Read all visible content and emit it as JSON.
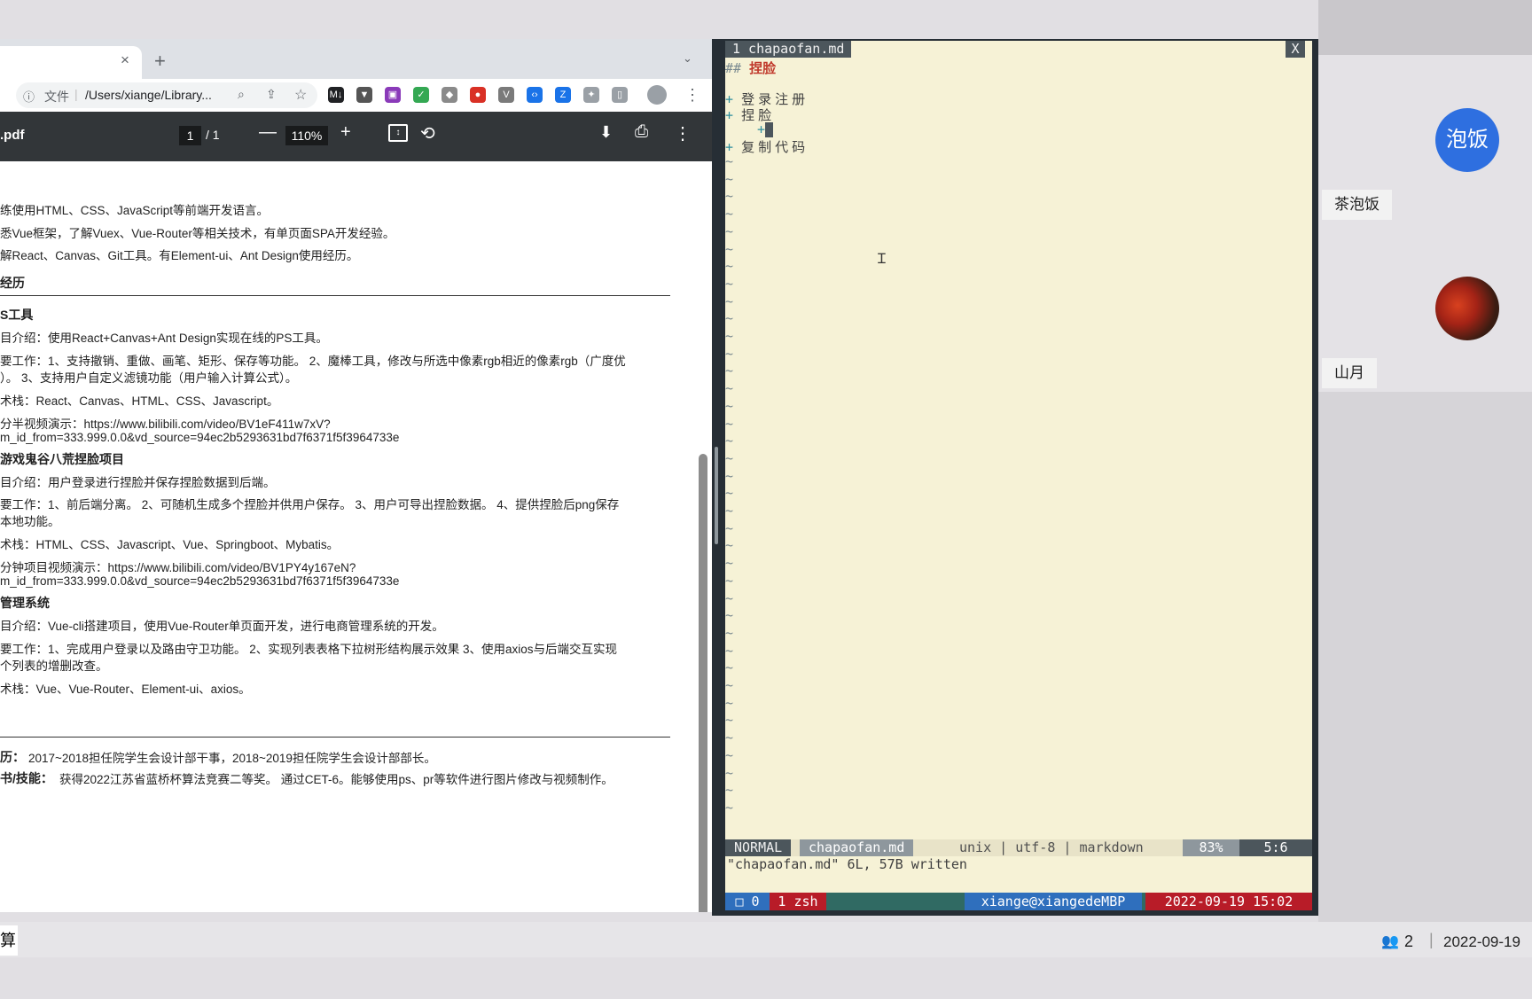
{
  "browser": {
    "tab_close": "×",
    "new_tab": "+",
    "tab_dropdown": "⌄",
    "omnibox": {
      "info_icon": "ⓘ",
      "file_label": "文件",
      "separator": "|",
      "url": "/Users/xiange/Library...",
      "zoom_icon": "⌕",
      "share_icon": "⇪",
      "star_icon": "☆"
    },
    "extensions": [
      {
        "name": "markdown-extension-icon",
        "glyph": "M↓",
        "color": "#202124"
      },
      {
        "name": "vuetify-extension-icon",
        "glyph": "▼",
        "color": "#555555"
      },
      {
        "name": "window-extension-icon",
        "glyph": "▣",
        "color": "#8a3ab9"
      },
      {
        "name": "green-check-extension-icon",
        "glyph": "✓",
        "color": "#34a853"
      },
      {
        "name": "shield-extension-icon",
        "glyph": "◆",
        "color": "#8a8a8a"
      },
      {
        "name": "red-shield-extension-icon",
        "glyph": "●",
        "color": "#d93025"
      },
      {
        "name": "vue-devtools-extension-icon",
        "glyph": "V",
        "color": "#7a7a7a"
      },
      {
        "name": "code-extension-icon",
        "glyph": "‹›",
        "color": "#1a73e8"
      },
      {
        "name": "z-extension-icon",
        "glyph": "Z",
        "color": "#1a73e8"
      },
      {
        "name": "puzzle-extension-icon",
        "glyph": "✦",
        "color": "#9aa0a6"
      },
      {
        "name": "sidebar-extension-icon",
        "glyph": "▯",
        "color": "#9aa0a6"
      }
    ],
    "more_icon": "⋮"
  },
  "pdf": {
    "title": ".pdf",
    "page_current": "1",
    "page_sep": "/  1",
    "zoom_out": "—",
    "zoom": "110%",
    "zoom_in": "+",
    "fit_icon": "↕",
    "rotate_icon": "⟲",
    "download_icon": "⬇",
    "print_icon": "⎙",
    "more_icon": "⋮"
  },
  "doc_lines": [
    "练使用HTML、CSS、JavaScript等前端开发语言。",
    "悉Vue框架，了解Vuex、Vue-Router等相关技术，有单页面SPA开发经验。",
    "解React、Canvas、Git工具。有Element-ui、Ant Design使用经历。",
    "经历",
    "S工具",
    "目介绍：使用React+Canvas+Ant Design实现在线的PS工具。",
    "要工作：1、支持撤销、重做、画笔、矩形、保存等功能。  2、魔棒工具，修改与所选中像素rgb相近的像素rgb（广度优",
    "）。  3、支持用户自定义滤镜功能（用户输入计算公式）。",
    "术栈：React、Canvas、HTML、CSS、Javascript。",
    "分半视频演示：https://www.bilibili.com/video/BV1eF411w7xV?",
    "m_id_from=333.999.0.0&vd_source=94ec2b5293631bd7f6371f5f3964733e",
    "游戏鬼谷八荒捏脸项目",
    "目介绍：用户登录进行捏脸并保存捏脸数据到后端。",
    "要工作：1、前后端分离。  2、可随机生成多个捏脸并供用户保存。  3、用户可导出捏脸数据。  4、提供捏脸后png保存",
    "本地功能。",
    "术栈：HTML、CSS、Javascript、Vue、Springboot、Mybatis。",
    "分钟项目视频演示：https://www.bilibili.com/video/BV1PY4y167eN?",
    "m_id_from=333.999.0.0&vd_source=94ec2b5293631bd7f6371f5f3964733e",
    "管理系统",
    "目介绍：Vue-cli搭建项目，使用Vue-Router单页面开发，进行电商管理系统的开发。",
    "要工作：1、完成用户登录以及路由守卫功能。   2、实现列表表格下拉树形结构展示效果   3、使用axios与后端交互实现",
    "个列表的增删改查。",
    "术栈：Vue、Vue-Router、Element-ui、axios。",
    "历：",
    "2017~2018担任院学生会设计部干事，2018~2019担任院学生会设计部部长。",
    "书/技能：",
    "获得2022江苏省蓝桥杯算法竞赛二等奖。 通过CET-6。能够使用ps、pr等软件进行图片修改与视频制作。"
  ],
  "vim": {
    "tab_label": "1 chapaofan.md",
    "tab_close": "X",
    "heading_marker": "##",
    "heading_text": "捏脸",
    "list": [
      {
        "marker": "+",
        "text": "登录注册"
      },
      {
        "marker": "+",
        "text": "捏脸"
      },
      {
        "marker": "+",
        "text": ""
      },
      {
        "marker": "+",
        "text": "复制代码"
      }
    ],
    "tilde": "~",
    "mode": "NORMAL",
    "file": "chapaofan.md",
    "format": "unix | utf-8 | markdown",
    "percent": "83%",
    "position": "5:6",
    "message": "\"chapaofan.md\" 6L, 57B written",
    "tmux_window0": "□ 0",
    "tmux_window1": "1 zsh",
    "tmux_host": "xiange@xiangedeMBP",
    "tmux_time": "2022-09-19 15:02"
  },
  "meeting": {
    "participant1_avatar_text": "泡饭",
    "participant1_name": "茶泡饭",
    "participant2_name": "山月",
    "participant_count": "2",
    "date": "2022-09-19",
    "bottom_left_text": "算"
  },
  "colors": {
    "vim_bg": "#f6f2d6",
    "vim_heading": "#c0392b",
    "tmux_blue": "#2f6fbd",
    "tmux_red": "#b81c28",
    "avatar_blue": "#2e6fe0"
  }
}
